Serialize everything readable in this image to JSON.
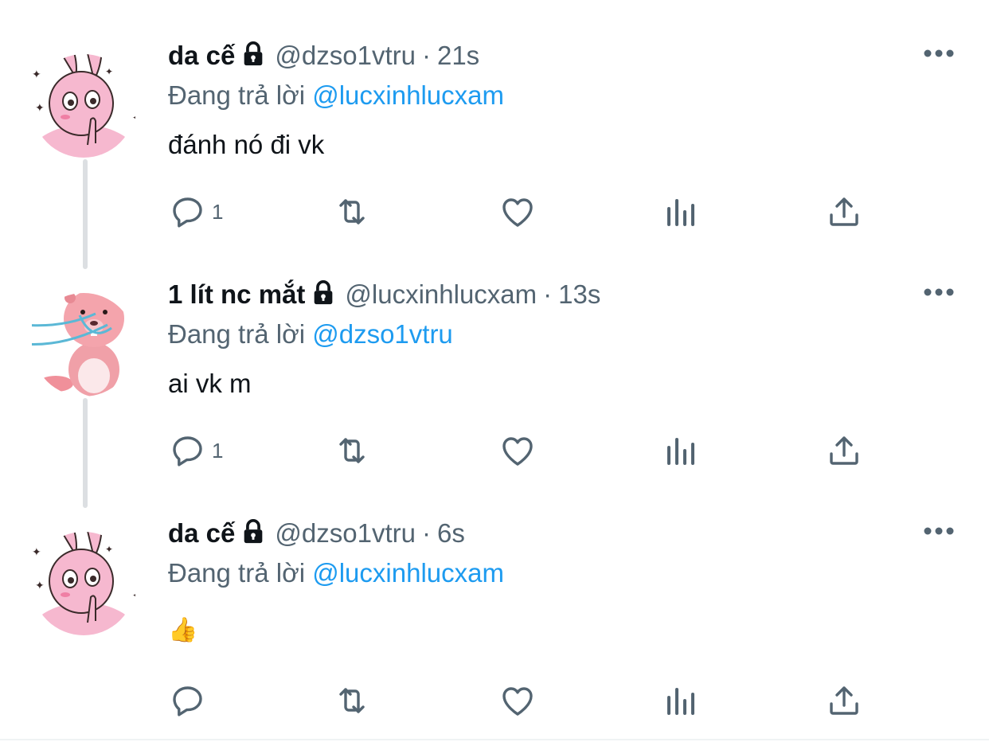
{
  "tweets": [
    {
      "name": "da cế",
      "handle": "@dzso1vtru",
      "separator": "·",
      "time": "21s",
      "reply_prefix": "Đang trả lời",
      "reply_to": "@lucxinhlucxam",
      "text": "đánh nó đi vk",
      "reply_count": "1",
      "avatar_icon": "pink-bunny-avatar"
    },
    {
      "name": "1 lít nc mắt",
      "handle": "@lucxinhlucxam",
      "separator": "·",
      "time": "13s",
      "reply_prefix": "Đang trả lời",
      "reply_to": "@dzso1vtru",
      "text": "ai vk m",
      "reply_count": "1",
      "avatar_icon": "pink-beaver-avatar"
    },
    {
      "name": "da cế",
      "handle": "@dzso1vtru",
      "separator": "·",
      "time": "6s",
      "reply_prefix": "Đang trả lời",
      "reply_to": "@lucxinhlucxam",
      "text": "👍",
      "reply_count": "",
      "avatar_icon": "pink-bunny-avatar"
    }
  ],
  "icons": {
    "reply": "reply-icon",
    "retweet": "retweet-icon",
    "like": "heart-icon",
    "views": "views-icon",
    "share": "share-icon",
    "more": "more-icon",
    "protected": "lock-icon"
  },
  "colors": {
    "text": "#0f1419",
    "secondary": "#536471",
    "link": "#1d9bf0",
    "thread_line": "#dcdfe2",
    "avatar_pink": "#f6b8cf"
  }
}
